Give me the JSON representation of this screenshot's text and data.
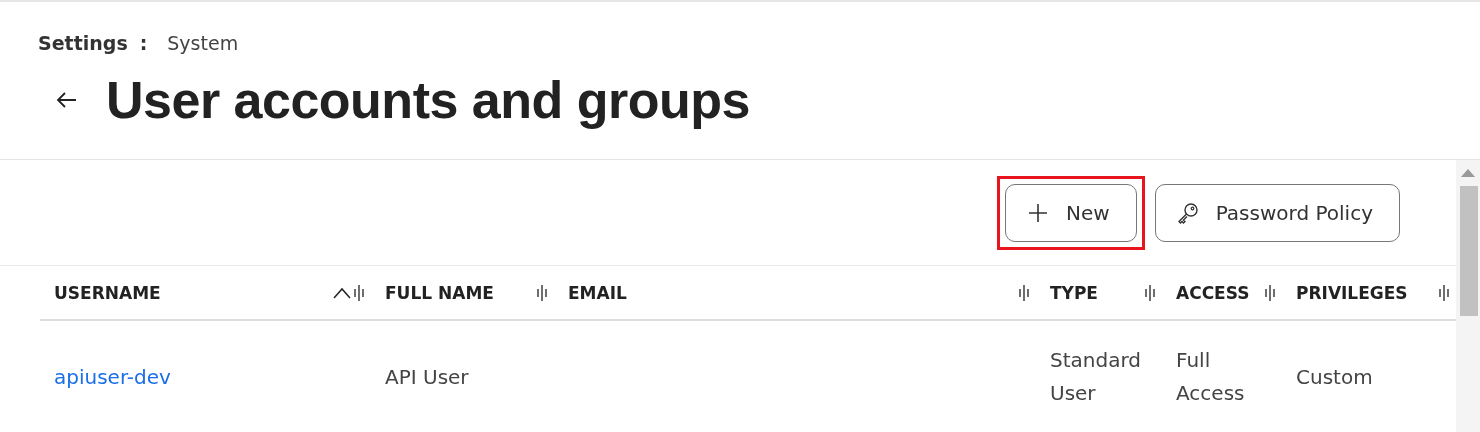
{
  "breadcrumb": {
    "items": [
      {
        "label": "Settings",
        "current": false
      },
      {
        "label": "System",
        "current": true
      }
    ],
    "separator": ":"
  },
  "page": {
    "title": "User accounts and groups"
  },
  "toolbar": {
    "buttons": [
      {
        "label": "New",
        "kind": "add",
        "highlighted": true
      },
      {
        "label": "Password Policy",
        "kind": "key",
        "highlighted": false
      }
    ]
  },
  "table": {
    "columns": [
      {
        "label": "USERNAME",
        "sorted": true
      },
      {
        "label": "FULL NAME",
        "sorted": false
      },
      {
        "label": "EMAIL",
        "sorted": false
      },
      {
        "label": "TYPE",
        "sorted": false
      },
      {
        "label": "ACCESS",
        "sorted": false
      },
      {
        "label": "PRIVILEGES",
        "sorted": false
      }
    ],
    "rows": [
      {
        "username": "apiuser-dev",
        "full_name": "API User",
        "type": "Standard User",
        "access": "Full Access",
        "privileges": "Custom"
      }
    ]
  }
}
